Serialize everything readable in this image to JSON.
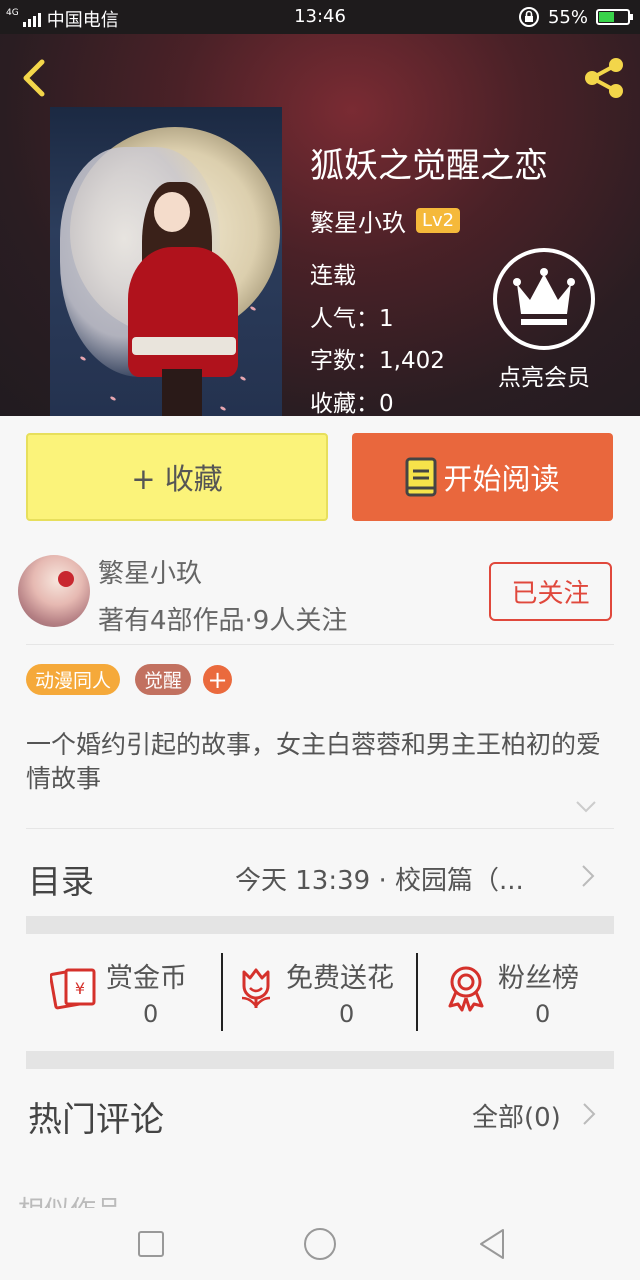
{
  "status_bar": {
    "carrier": "中国电信",
    "network": "4G",
    "time": "13:46",
    "battery": "55%",
    "battery_level": 0.55
  },
  "book": {
    "title": "狐妖之觉醒之恋",
    "author": "繁星小玖",
    "level": "Lv2",
    "status": "连载",
    "popularity": "人气：1",
    "word_count": "字数：1,402",
    "favorites": "收藏：0"
  },
  "vip": {
    "label": "点亮会员"
  },
  "actions": {
    "collect": "+ 收藏",
    "read": "开始阅读"
  },
  "author_card": {
    "name": "繁星小玖",
    "meta": "著有4部作品·9人关注",
    "follow_label": "已关注"
  },
  "tags": [
    {
      "label": "动漫同人",
      "color": "#f5a93a"
    },
    {
      "label": "觉醒",
      "color": "#c27160"
    }
  ],
  "tag_add": "+",
  "description": "一个婚约引起的故事，女主白蓉蓉和男主王柏初的爱情故事",
  "toc": {
    "label": "目录",
    "latest": "今天 13:39 · 校园篇（..."
  },
  "stats": [
    {
      "label": "赏金币",
      "value": "0",
      "icon": "red-envelope-icon"
    },
    {
      "label": "免费送花",
      "value": "0",
      "icon": "flower-icon"
    },
    {
      "label": "粉丝榜",
      "value": "0",
      "icon": "medal-icon"
    }
  ],
  "comments": {
    "label": "热门评论",
    "all": "全部(0)"
  },
  "similar": {
    "label": "相似作品"
  },
  "colors": {
    "accent_orange": "#e9673d",
    "collect_yellow": "#fbf37a",
    "follow_red": "#e0483c",
    "icon_red": "#d5312b",
    "level_gold": "#f5b93a"
  }
}
